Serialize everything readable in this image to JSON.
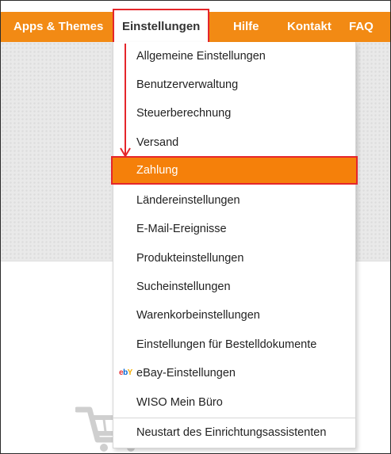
{
  "nav": {
    "items": [
      {
        "label": "Apps & Themes"
      },
      {
        "label": "Einstellungen"
      },
      {
        "label": "Hilfe"
      },
      {
        "label": "Kontakt"
      },
      {
        "label": "FAQ"
      }
    ]
  },
  "menu": {
    "items": [
      {
        "label": "Allgemeine Einstellungen"
      },
      {
        "label": "Benutzerverwaltung"
      },
      {
        "label": "Steuerberechnung"
      },
      {
        "label": "Versand"
      },
      {
        "label": "Zahlung"
      },
      {
        "label": "Ländereinstellungen"
      },
      {
        "label": "E-Mail-Ereignisse"
      },
      {
        "label": "Produkteinstellungen"
      },
      {
        "label": "Sucheinstellungen"
      },
      {
        "label": "Warenkorbeinstellungen"
      },
      {
        "label": "Einstellungen für Bestelldokumente"
      },
      {
        "label": "eBay-Einstellungen",
        "icon": "ebay-icon"
      },
      {
        "label": "WISO Mein Büro"
      },
      {
        "label": "Neustart des Einrichtungsassistenten"
      }
    ],
    "selected_item": "Zahlung"
  },
  "colors": {
    "nav_bg": "#f28a14",
    "highlight_border": "#e5262b",
    "selected_bg": "#f5800a"
  }
}
